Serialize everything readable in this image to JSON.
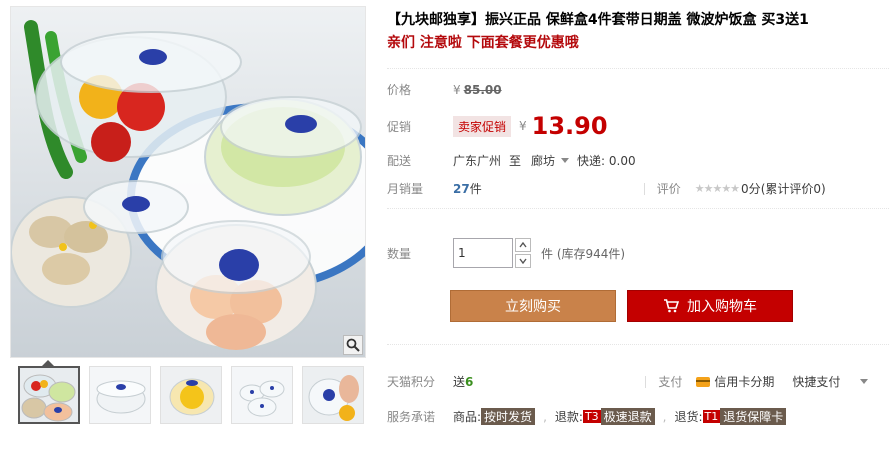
{
  "product": {
    "title": "【九块邮独享】振兴正品 保鲜盒4件套带日期盖 微波炉饭盒 买3送1",
    "subtitle": "亲们 注意啦 下面套餐更优惠哦"
  },
  "price": {
    "label": "价格",
    "currency": "¥",
    "original": "85.00"
  },
  "promo": {
    "label": "促销",
    "tag": "卖家促销",
    "currency": "¥",
    "price": "13.90"
  },
  "shipping": {
    "label": "配送",
    "origin": "广东广州",
    "to_word": "至",
    "destination": "廊坊",
    "express": "快递: 0.00"
  },
  "sales": {
    "label": "月销量",
    "count": "27",
    "unit": "件",
    "rating_label": "评价",
    "stars": "★★★★★",
    "score": "0分",
    "reviews_link": "(累计评价0)"
  },
  "quantity": {
    "label": "数量",
    "value": "1",
    "stock": "件 (库存944件)"
  },
  "buttons": {
    "buy_now": "立刻购买",
    "add_cart": "加入购物车"
  },
  "points": {
    "label": "天猫积分",
    "send": "送",
    "value": "6",
    "pay_label": "支付",
    "credit_installment": "信用卡分期",
    "quick_pay": "快捷支付"
  },
  "service": {
    "label": "服务承诺",
    "goods_label": "商品:",
    "goods_badge": "按时发货",
    "refund_label": "退款:",
    "refund_t": "T3",
    "refund_badge": "极速退款",
    "return_label": "退货:",
    "return_t": "T1",
    "return_badge": "退货保障卡"
  },
  "colors": {
    "accent_red": "#c40000",
    "buy_orange": "#c9824a",
    "link_blue": "#3a6ea5"
  },
  "icons": [
    "zoom-icon",
    "cart-icon",
    "credit-card-icon",
    "chevron-down-icon",
    "star-icon"
  ]
}
